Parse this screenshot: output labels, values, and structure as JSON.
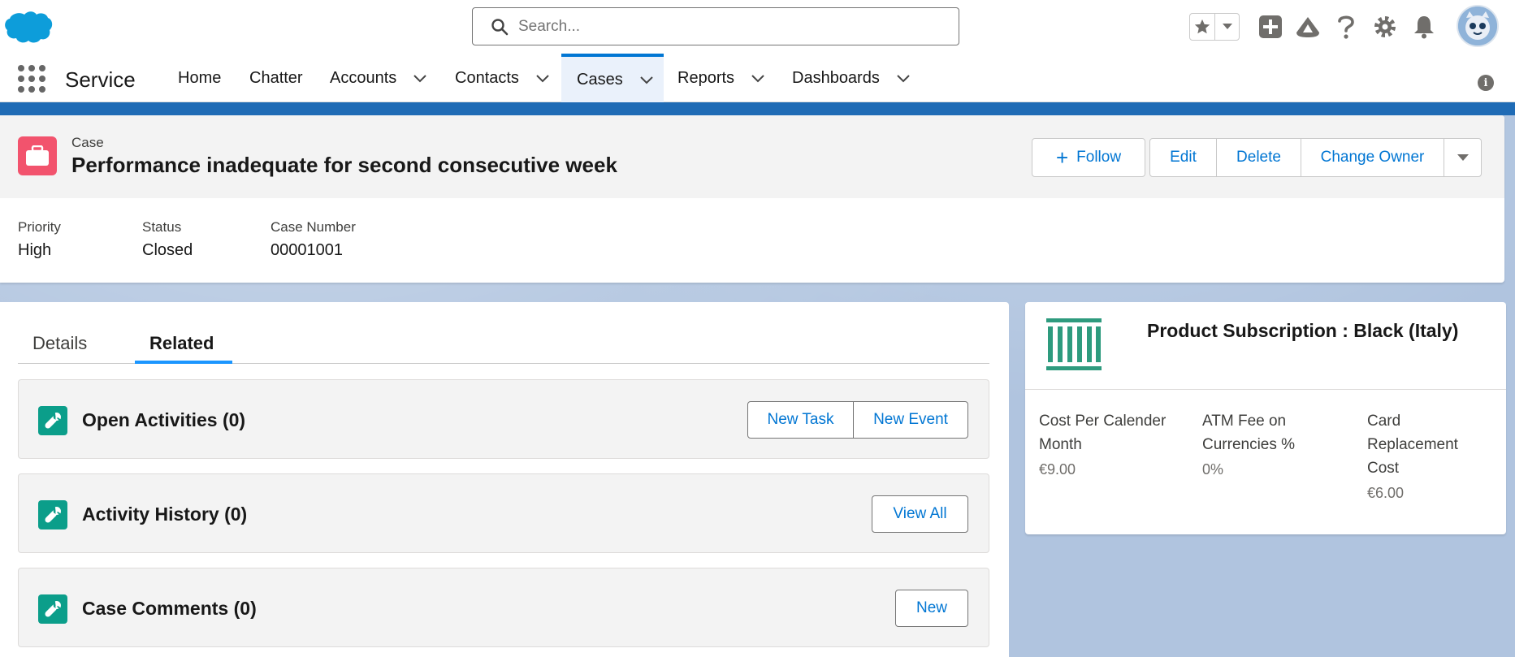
{
  "header": {
    "search_placeholder": "Search..."
  },
  "nav": {
    "app_name": "Service",
    "items": [
      {
        "label": "Home"
      },
      {
        "label": "Chatter"
      },
      {
        "label": "Accounts"
      },
      {
        "label": "Contacts"
      },
      {
        "label": "Cases"
      },
      {
        "label": "Reports"
      },
      {
        "label": "Dashboards"
      }
    ],
    "info": "i"
  },
  "record": {
    "entity": "Case",
    "title": "Performance inadequate for second consecutive week",
    "actions": {
      "follow": "Follow",
      "edit": "Edit",
      "delete": "Delete",
      "change_owner": "Change Owner"
    },
    "fields": [
      {
        "label": "Priority",
        "value": "High"
      },
      {
        "label": "Status",
        "value": "Closed"
      },
      {
        "label": "Case Number",
        "value": "00001001"
      }
    ]
  },
  "tabs": [
    {
      "label": "Details"
    },
    {
      "label": "Related"
    }
  ],
  "related": [
    {
      "title": "Open Activities (0)",
      "buttons": [
        "New Task",
        "New Event"
      ]
    },
    {
      "title": "Activity History (0)",
      "buttons": [
        "View All"
      ]
    },
    {
      "title": "Case Comments (0)",
      "buttons": [
        "New"
      ]
    }
  ],
  "subscription": {
    "title": "Product Subscription : Black (Italy)",
    "fields": [
      {
        "label": "Cost Per Calender Month",
        "value": "€9.00"
      },
      {
        "label": "ATM Fee on Currencies %",
        "value": "0%"
      },
      {
        "label": "Card Replacement Cost",
        "value": "€6.00"
      }
    ]
  },
  "colors": {
    "brand_blue": "#0176d3",
    "case_icon": "#f2536d",
    "related_icon": "#0b9e8a",
    "subscription_icon": "#2e9b7e"
  }
}
